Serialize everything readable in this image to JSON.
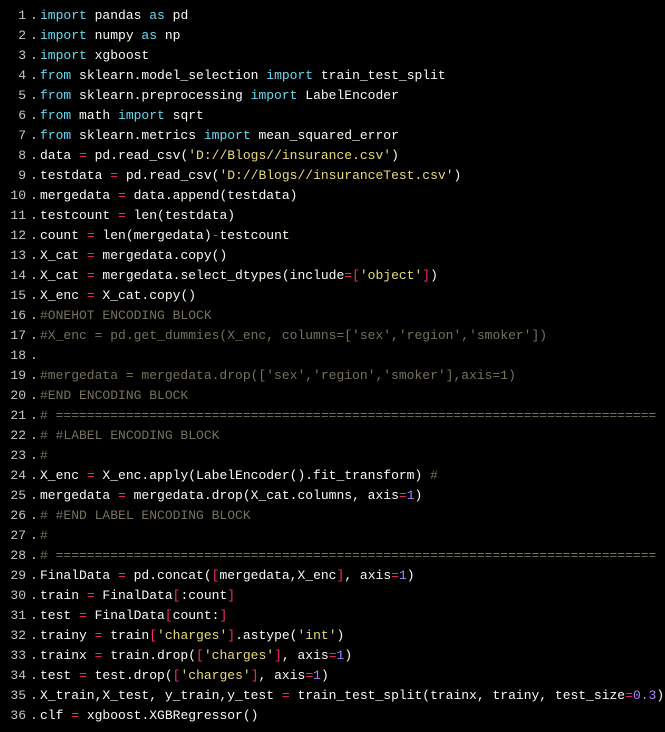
{
  "lines": [
    {
      "n": "1",
      "tokens": [
        {
          "c": "kw",
          "t": "import"
        },
        {
          "c": "ident",
          "t": " pandas "
        },
        {
          "c": "kw",
          "t": "as"
        },
        {
          "c": "ident",
          "t": " pd"
        }
      ]
    },
    {
      "n": "2",
      "tokens": [
        {
          "c": "kw",
          "t": "import"
        },
        {
          "c": "ident",
          "t": " numpy "
        },
        {
          "c": "kw",
          "t": "as"
        },
        {
          "c": "ident",
          "t": " np"
        }
      ]
    },
    {
      "n": "3",
      "tokens": [
        {
          "c": "kw",
          "t": "import"
        },
        {
          "c": "ident",
          "t": " xgboost"
        }
      ]
    },
    {
      "n": "4",
      "tokens": [
        {
          "c": "kw",
          "t": "from"
        },
        {
          "c": "ident",
          "t": " sklearn.model_selection "
        },
        {
          "c": "kw",
          "t": "import"
        },
        {
          "c": "ident",
          "t": " train_test_split"
        }
      ]
    },
    {
      "n": "5",
      "tokens": [
        {
          "c": "kw",
          "t": "from"
        },
        {
          "c": "ident",
          "t": " sklearn.preprocessing "
        },
        {
          "c": "kw",
          "t": "import"
        },
        {
          "c": "ident",
          "t": " LabelEncoder"
        }
      ]
    },
    {
      "n": "6",
      "tokens": [
        {
          "c": "kw",
          "t": "from"
        },
        {
          "c": "ident",
          "t": " math "
        },
        {
          "c": "kw",
          "t": "import"
        },
        {
          "c": "ident",
          "t": " sqrt"
        }
      ]
    },
    {
      "n": "7",
      "tokens": [
        {
          "c": "kw",
          "t": "from"
        },
        {
          "c": "ident",
          "t": " sklearn.metrics "
        },
        {
          "c": "kw",
          "t": "import"
        },
        {
          "c": "ident",
          "t": " mean_squared_error"
        }
      ]
    },
    {
      "n": "8",
      "tokens": [
        {
          "c": "ident",
          "t": "data "
        },
        {
          "c": "op",
          "t": "="
        },
        {
          "c": "ident",
          "t": " pd.read_csv("
        },
        {
          "c": "str",
          "t": "'D://Blogs//insurance.csv'"
        },
        {
          "c": "ident",
          "t": ")"
        }
      ]
    },
    {
      "n": "9",
      "tokens": [
        {
          "c": "ident",
          "t": "testdata "
        },
        {
          "c": "op",
          "t": "="
        },
        {
          "c": "ident",
          "t": " pd.read_csv("
        },
        {
          "c": "str",
          "t": "'D://Blogs//insuranceTest.csv'"
        },
        {
          "c": "ident",
          "t": ")"
        }
      ]
    },
    {
      "n": "10",
      "tokens": [
        {
          "c": "ident",
          "t": "mergedata "
        },
        {
          "c": "op",
          "t": "="
        },
        {
          "c": "ident",
          "t": " data.append(testdata)"
        }
      ]
    },
    {
      "n": "11",
      "tokens": [
        {
          "c": "ident",
          "t": "testcount "
        },
        {
          "c": "op",
          "t": "="
        },
        {
          "c": "ident",
          "t": " len(testdata)"
        }
      ]
    },
    {
      "n": "12",
      "tokens": [
        {
          "c": "ident",
          "t": "count "
        },
        {
          "c": "op",
          "t": "="
        },
        {
          "c": "ident",
          "t": " len(mergedata)"
        },
        {
          "c": "op",
          "t": "-"
        },
        {
          "c": "ident",
          "t": "testcount"
        }
      ]
    },
    {
      "n": "13",
      "tokens": [
        {
          "c": "ident",
          "t": "X_cat "
        },
        {
          "c": "op",
          "t": "="
        },
        {
          "c": "ident",
          "t": " mergedata.copy()"
        }
      ]
    },
    {
      "n": "14",
      "tokens": [
        {
          "c": "ident",
          "t": "X_cat "
        },
        {
          "c": "op",
          "t": "="
        },
        {
          "c": "ident",
          "t": " mergedata.select_dtypes(include"
        },
        {
          "c": "op",
          "t": "=["
        },
        {
          "c": "str",
          "t": "'object'"
        },
        {
          "c": "op",
          "t": "]"
        },
        {
          "c": "ident",
          "t": ")"
        }
      ]
    },
    {
      "n": "15",
      "tokens": [
        {
          "c": "ident",
          "t": "X_enc "
        },
        {
          "c": "op",
          "t": "="
        },
        {
          "c": "ident",
          "t": " X_cat.copy()"
        }
      ]
    },
    {
      "n": "16",
      "tokens": [
        {
          "c": "cmt",
          "t": "#ONEHOT ENCODING BLOCK"
        }
      ]
    },
    {
      "n": "17",
      "tokens": [
        {
          "c": "cmt",
          "t": "#X_enc = pd.get_dummies(X_enc, columns=['sex','region','smoker'])"
        }
      ]
    },
    {
      "n": "18",
      "tokens": [
        {
          "c": "ident",
          "t": ""
        }
      ]
    },
    {
      "n": "19",
      "tokens": [
        {
          "c": "cmt",
          "t": "#mergedata = mergedata.drop(['sex','region','smoker'],axis=1)"
        }
      ]
    },
    {
      "n": "20",
      "tokens": [
        {
          "c": "cmt",
          "t": "#END ENCODING BLOCK"
        }
      ]
    },
    {
      "n": "21",
      "tokens": [
        {
          "c": "cmt",
          "t": "# ============================================================================="
        }
      ]
    },
    {
      "n": "22",
      "tokens": [
        {
          "c": "cmt",
          "t": "# #LABEL ENCODING BLOCK"
        }
      ]
    },
    {
      "n": "23",
      "tokens": [
        {
          "c": "cmt",
          "t": "#"
        }
      ]
    },
    {
      "n": "24",
      "tokens": [
        {
          "c": "ident",
          "t": "X_enc "
        },
        {
          "c": "op",
          "t": "="
        },
        {
          "c": "ident",
          "t": " X_enc.apply(LabelEncoder().fit_transform) "
        },
        {
          "c": "cmt",
          "t": "#"
        }
      ]
    },
    {
      "n": "25",
      "tokens": [
        {
          "c": "ident",
          "t": "mergedata "
        },
        {
          "c": "op",
          "t": "="
        },
        {
          "c": "ident",
          "t": " mergedata.drop(X_cat.columns, axis"
        },
        {
          "c": "op",
          "t": "="
        },
        {
          "c": "num",
          "t": "1"
        },
        {
          "c": "ident",
          "t": ")"
        }
      ]
    },
    {
      "n": "26",
      "tokens": [
        {
          "c": "cmt",
          "t": "# #END LABEL ENCODING BLOCK"
        }
      ]
    },
    {
      "n": "27",
      "tokens": [
        {
          "c": "cmt",
          "t": "#"
        }
      ]
    },
    {
      "n": "28",
      "tokens": [
        {
          "c": "cmt",
          "t": "# ============================================================================="
        }
      ]
    },
    {
      "n": "29",
      "tokens": [
        {
          "c": "ident",
          "t": "FinalData "
        },
        {
          "c": "op",
          "t": "="
        },
        {
          "c": "ident",
          "t": " pd.concat("
        },
        {
          "c": "op",
          "t": "["
        },
        {
          "c": "ident",
          "t": "mergedata,X_enc"
        },
        {
          "c": "op",
          "t": "]"
        },
        {
          "c": "ident",
          "t": ", axis"
        },
        {
          "c": "op",
          "t": "="
        },
        {
          "c": "num",
          "t": "1"
        },
        {
          "c": "ident",
          "t": ")"
        }
      ]
    },
    {
      "n": "30",
      "tokens": [
        {
          "c": "ident",
          "t": "train "
        },
        {
          "c": "op",
          "t": "="
        },
        {
          "c": "ident",
          "t": " FinalData"
        },
        {
          "c": "op",
          "t": "["
        },
        {
          "c": "ident",
          "t": ":count"
        },
        {
          "c": "op",
          "t": "]"
        }
      ]
    },
    {
      "n": "31",
      "tokens": [
        {
          "c": "ident",
          "t": "test "
        },
        {
          "c": "op",
          "t": "="
        },
        {
          "c": "ident",
          "t": " FinalData"
        },
        {
          "c": "op",
          "t": "["
        },
        {
          "c": "ident",
          "t": "count:"
        },
        {
          "c": "op",
          "t": "]"
        }
      ]
    },
    {
      "n": "32",
      "tokens": [
        {
          "c": "ident",
          "t": "trainy "
        },
        {
          "c": "op",
          "t": "="
        },
        {
          "c": "ident",
          "t": " train"
        },
        {
          "c": "op",
          "t": "["
        },
        {
          "c": "str",
          "t": "'charges'"
        },
        {
          "c": "op",
          "t": "]"
        },
        {
          "c": "ident",
          "t": ".astype("
        },
        {
          "c": "str",
          "t": "'int'"
        },
        {
          "c": "ident",
          "t": ")"
        }
      ]
    },
    {
      "n": "33",
      "tokens": [
        {
          "c": "ident",
          "t": "trainx "
        },
        {
          "c": "op",
          "t": "="
        },
        {
          "c": "ident",
          "t": " train.drop("
        },
        {
          "c": "op",
          "t": "["
        },
        {
          "c": "str",
          "t": "'charges'"
        },
        {
          "c": "op",
          "t": "]"
        },
        {
          "c": "ident",
          "t": ", axis"
        },
        {
          "c": "op",
          "t": "="
        },
        {
          "c": "num",
          "t": "1"
        },
        {
          "c": "ident",
          "t": ")"
        }
      ]
    },
    {
      "n": "34",
      "tokens": [
        {
          "c": "ident",
          "t": "test "
        },
        {
          "c": "op",
          "t": "="
        },
        {
          "c": "ident",
          "t": " test.drop("
        },
        {
          "c": "op",
          "t": "["
        },
        {
          "c": "str",
          "t": "'charges'"
        },
        {
          "c": "op",
          "t": "]"
        },
        {
          "c": "ident",
          "t": ", axis"
        },
        {
          "c": "op",
          "t": "="
        },
        {
          "c": "num",
          "t": "1"
        },
        {
          "c": "ident",
          "t": ")"
        }
      ]
    },
    {
      "n": "35",
      "tokens": [
        {
          "c": "ident",
          "t": "X_train,X_test, y_train,y_test "
        },
        {
          "c": "op",
          "t": "="
        },
        {
          "c": "ident",
          "t": " train_test_split(trainx, trainy, test_size"
        },
        {
          "c": "op",
          "t": "="
        },
        {
          "c": "num",
          "t": "0.3"
        },
        {
          "c": "ident",
          "t": ")"
        }
      ]
    },
    {
      "n": "36",
      "tokens": [
        {
          "c": "ident",
          "t": "clf "
        },
        {
          "c": "op",
          "t": "="
        },
        {
          "c": "ident",
          "t": " xgboost.XGBRegressor()"
        }
      ]
    }
  ],
  "dot": "."
}
